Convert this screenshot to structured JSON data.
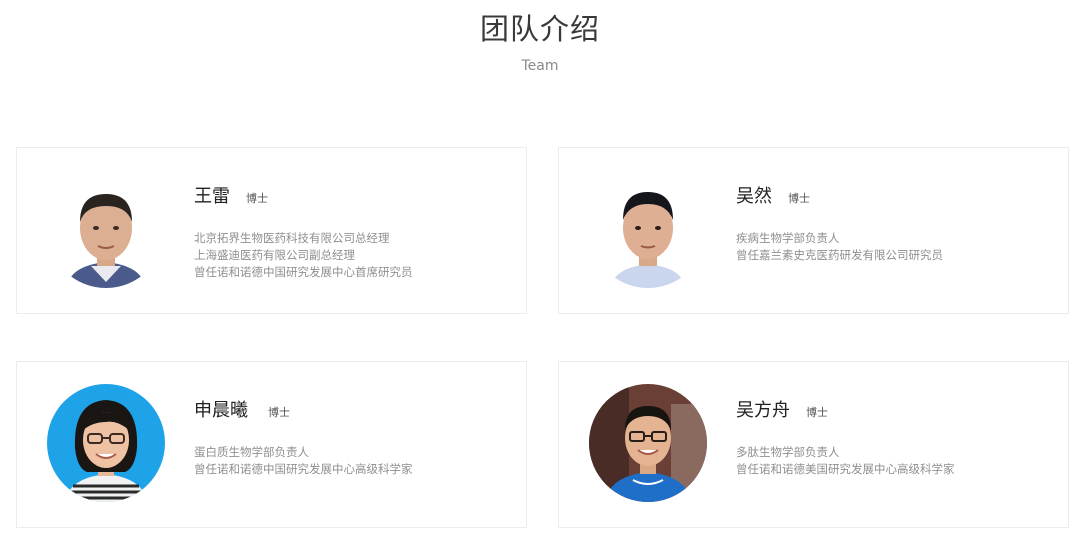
{
  "section": {
    "title": "团队介绍",
    "subtitle": "Team"
  },
  "members": [
    {
      "name": "王雷",
      "degree": "博士",
      "lines": [
        "北京拓界生物医药科技有限公司总经理",
        "上海盛迪医药有限公司副总经理",
        "曾任诺和诺德中国研究发展中心首席研究员"
      ]
    },
    {
      "name": "吴然",
      "degree": "博士",
      "lines": [
        "疾病生物学部负责人",
        "曾任嘉兰素史克医药研发有限公司研究员"
      ]
    },
    {
      "name": "申晨曦",
      "degree": "博士",
      "lines": [
        "蛋白质生物学部负责人",
        "曾任诺和诺德中国研究发展中心高级科学家"
      ]
    },
    {
      "name": "吴方舟",
      "degree": "博士",
      "lines": [
        "多肽生物学部负责人",
        "曾任诺和诺德美国研究发展中心高级科学家"
      ]
    }
  ]
}
